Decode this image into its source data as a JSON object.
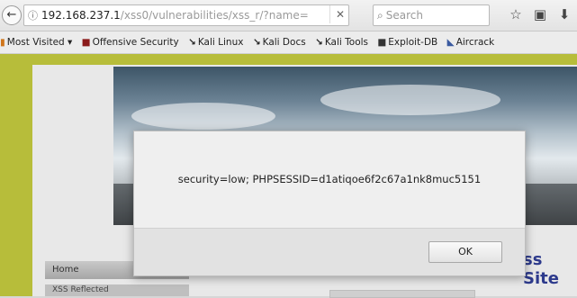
{
  "browser": {
    "url_host": "192.168.237.1",
    "url_path": "/xss0/vulnerabilities/xss_r/?name=",
    "search_placeholder": "Search",
    "icons": {
      "back": "back-arrow-icon",
      "identity": "page-info-icon",
      "clear": "close-icon",
      "search": "search-icon",
      "bookmark": "star-icon",
      "library": "clipboard-icon",
      "download": "download-icon"
    },
    "bookmarks": [
      {
        "label": "Most Visited ▾",
        "icon": "bookmark-folder-icon"
      },
      {
        "label": "Offensive Security",
        "icon": "offsec-icon"
      },
      {
        "label": "Kali Linux",
        "icon": "kali-dragon-icon"
      },
      {
        "label": "Kali Docs",
        "icon": "kali-dragon-icon"
      },
      {
        "label": "Kali Tools",
        "icon": "kali-dragon-icon"
      },
      {
        "label": "Exploit-DB",
        "icon": "exploit-db-icon"
      },
      {
        "label": "Aircrack",
        "icon": "aircrack-icon"
      }
    ]
  },
  "page": {
    "site_title_fragment": "ss Site",
    "menu_heading": "Home",
    "menu_item": "XSS Reflected",
    "colors": {
      "page_bg": "#b7bd3a",
      "title": "#2d3a8c"
    }
  },
  "dialog": {
    "message": "security=low; PHPSESSID=d1atiqoe6f2c67a1nk8muc5151",
    "ok_label": "OK"
  }
}
